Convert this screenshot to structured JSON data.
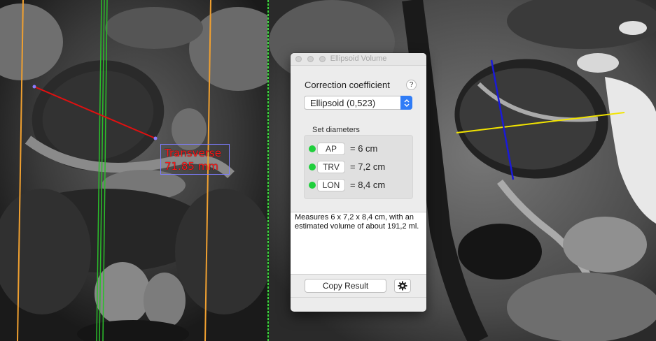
{
  "measurement": {
    "name": "Transverse",
    "value": "71.85 mm",
    "color": "#ff1818"
  },
  "window": {
    "title": "Ellipsoid Volume"
  },
  "correction": {
    "label": "Correction coefficient",
    "help": "?",
    "selected": "Ellipsoid (0,523)"
  },
  "diameters": {
    "group_label": "Set diameters",
    "rows": [
      {
        "key": "AP",
        "value": "= 6 cm",
        "status_color": "#1fcf3c"
      },
      {
        "key": "TRV",
        "value": "= 7,2 cm",
        "status_color": "#1fcf3c"
      },
      {
        "key": "LON",
        "value": "= 8,4 cm",
        "status_color": "#1fcf3c"
      }
    ]
  },
  "result_text": "Measures 6 x 7,2 x 8,4 cm, with an estimated volume of about 191,2 ml.",
  "copy_label": "Copy Result",
  "icons": {
    "select": "updown-chevron-icon",
    "settings": "gear-icon"
  }
}
